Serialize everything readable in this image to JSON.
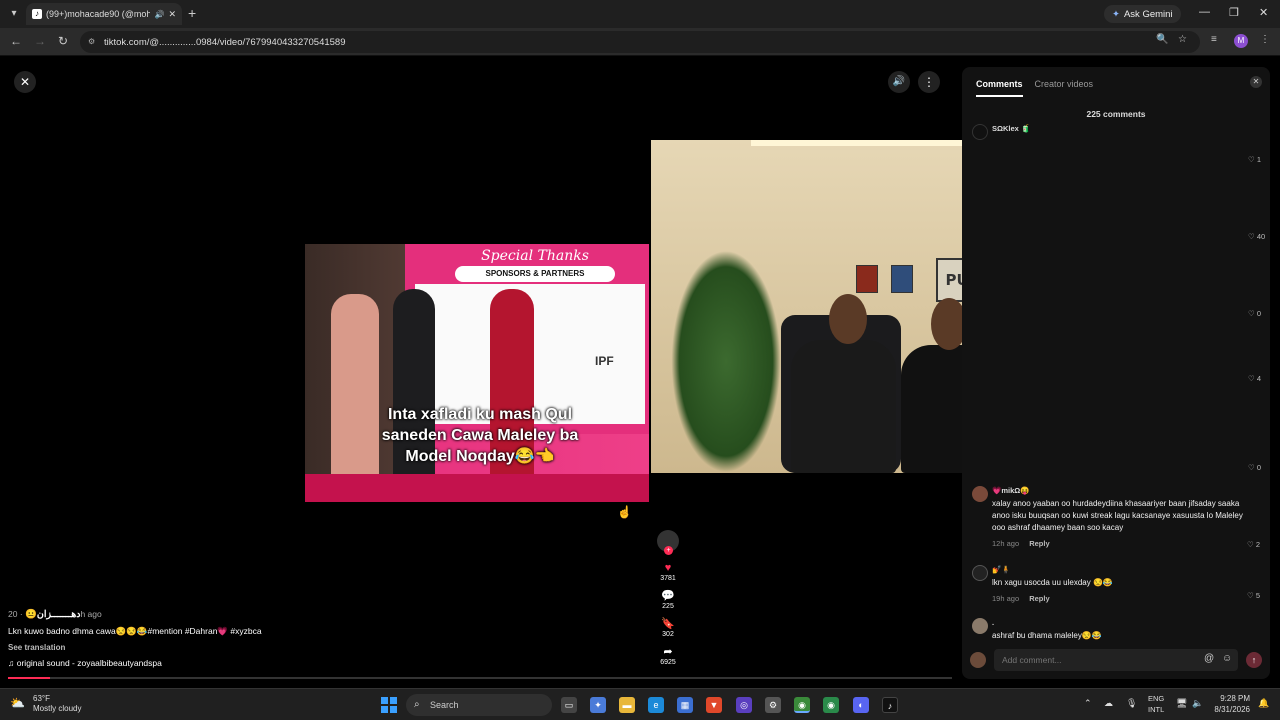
{
  "browser": {
    "tab_title": "(99+)mohacade90 (@moh...",
    "url": "tiktok.com/@..............0984/video/7679940433270541589",
    "ask_gemini": "Ask Gemini",
    "profile_initial": "M"
  },
  "player": {
    "overlay_caption": "Inta xafladi ku mash Qul saneden Cawa Maleley ba Model Noqday😂👈",
    "banner_heading": "Special Thanks",
    "banner_sub": "SPONSORS & PARTNERS",
    "banner_logo_text": "IPF",
    "wall_sign": "PUBG",
    "actions": {
      "likes": "3781",
      "comments": "225",
      "saves": "302",
      "shares": "6925"
    }
  },
  "video_info": {
    "author": "دهـــــــزان😐",
    "time_ago": "· 20h ago",
    "description": "Lkn kuwo badno dhma cawa😒😒😂#mention #Dahran💗 #xyzbca",
    "see_translation": "See translation",
    "music": "original sound - zoyaalbibeautyandspa"
  },
  "comments_panel": {
    "tabs": [
      "Comments",
      "Creator videos"
    ],
    "count_label": "225 comments",
    "side_likes": [
      "1",
      "40",
      "0",
      "4",
      "0"
    ],
    "comments": [
      {
        "user": "SΩKlex 🧃",
        "text": "",
        "time": "",
        "reply": "",
        "likes": ""
      },
      {
        "user": "💗mikΩ😝",
        "text": "xalay anoo yaaban oo hurdadeydiina khasaariyer baan jifsaday saaka anoo isku buuqsan oo kuwi streak lagu kacsanaye xasuusta lo Maleley ooo ashraf dhaamey baan soo kacay",
        "time": "12h ago",
        "reply": "Reply",
        "likes": "2"
      },
      {
        "user": "💅🧍",
        "text": "lkn xagu usocda uu ulexday 😒😂",
        "time": "19h ago",
        "reply": "Reply",
        "likes": "5"
      },
      {
        "user": ".",
        "text": "ashraf bu dhama maleley😒😂",
        "time": "",
        "reply": "",
        "likes": ""
      }
    ],
    "add_comment_placeholder": "Add comment..."
  },
  "taskbar": {
    "temp": "63°F",
    "weather": "Mostly cloudy",
    "search": "Search",
    "lang_top": "ENG",
    "lang_bottom": "INTL",
    "time": "9:28 PM",
    "date": "8/31/2026"
  }
}
